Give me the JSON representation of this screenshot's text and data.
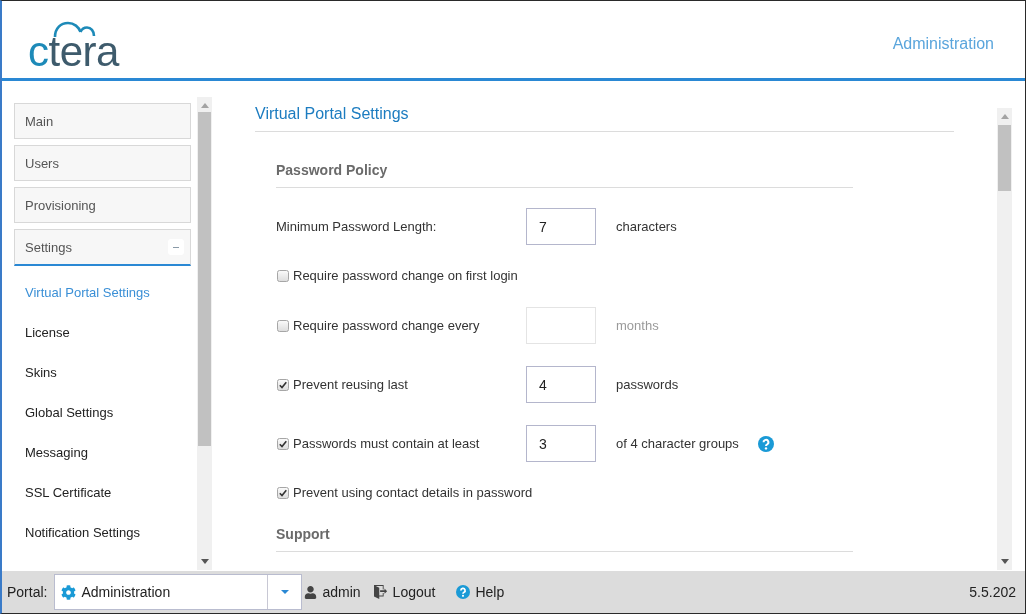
{
  "header": {
    "logo": "ctera",
    "title": "Administration"
  },
  "sidebar": {
    "sections": [
      {
        "label": "Main",
        "expanded": false
      },
      {
        "label": "Users",
        "expanded": false
      },
      {
        "label": "Provisioning",
        "expanded": false
      },
      {
        "label": "Settings",
        "expanded": true,
        "children": [
          {
            "label": "Virtual Portal Settings",
            "selected": true
          },
          {
            "label": "License",
            "selected": false
          },
          {
            "label": "Skins",
            "selected": false
          },
          {
            "label": "Global Settings",
            "selected": false
          },
          {
            "label": "Messaging",
            "selected": false
          },
          {
            "label": "SSL Certificate",
            "selected": false
          },
          {
            "label": "Notification Settings",
            "selected": false
          }
        ]
      }
    ]
  },
  "page": {
    "title": "Virtual Portal Settings",
    "sections": [
      {
        "heading": "Password Policy",
        "rows": [
          {
            "kind": "number",
            "label": "Minimum Password Length:",
            "value": "7",
            "unit": "characters"
          },
          {
            "kind": "checkbox",
            "label": "Require password change on first login",
            "checked": false
          },
          {
            "kind": "checkbox_number",
            "label": "Require password change every",
            "checked": false,
            "unit": "months",
            "disabled": true
          },
          {
            "kind": "checkbox_number",
            "label": "Prevent reusing last",
            "checked": true,
            "value": "4",
            "unit": "passwords",
            "disabled": false
          },
          {
            "kind": "checkbox_number",
            "label": "Passwords must contain at least",
            "checked": true,
            "value": "3",
            "unit": "of 4 character groups",
            "disabled": false,
            "help": true
          },
          {
            "kind": "checkbox",
            "label": "Prevent using contact details in password",
            "checked": true
          }
        ]
      },
      {
        "heading": "Support"
      }
    ]
  },
  "footer": {
    "portal_label": "Portal:",
    "portal": "Administration",
    "user": "admin",
    "logout": "Logout",
    "help": "Help",
    "version": "5.5.202"
  }
}
